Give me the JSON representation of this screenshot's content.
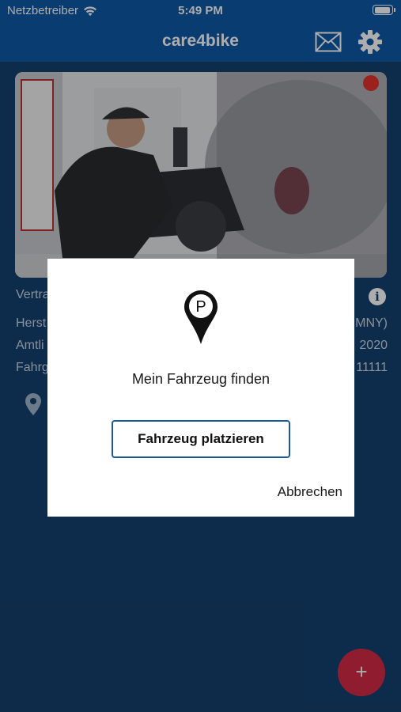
{
  "status_bar": {
    "carrier": "Netzbetreiber",
    "time": "5:49 PM"
  },
  "header": {
    "title": "care4bike",
    "icons": [
      "mail-icon",
      "gear-icon"
    ]
  },
  "vehicle_details": {
    "rows": [
      {
        "label": "Vertra",
        "value": ""
      },
      {
        "label": "Herst",
        "value": "MNY)"
      },
      {
        "label": "Amtli",
        "value": "2020"
      },
      {
        "label": "Fahrg",
        "value": "11111"
      }
    ]
  },
  "dialog": {
    "title": "Mein Fahrzeug finden",
    "pin_letter": "P",
    "place_button": "Fahrzeug platzieren",
    "cancel": "Abbrechen"
  },
  "fab": {
    "label": "+"
  },
  "colors": {
    "header_blue": "#0e5aa7",
    "background_navy": "#14406d",
    "fab_red": "#d52b46",
    "button_border": "#1a5a9b"
  }
}
